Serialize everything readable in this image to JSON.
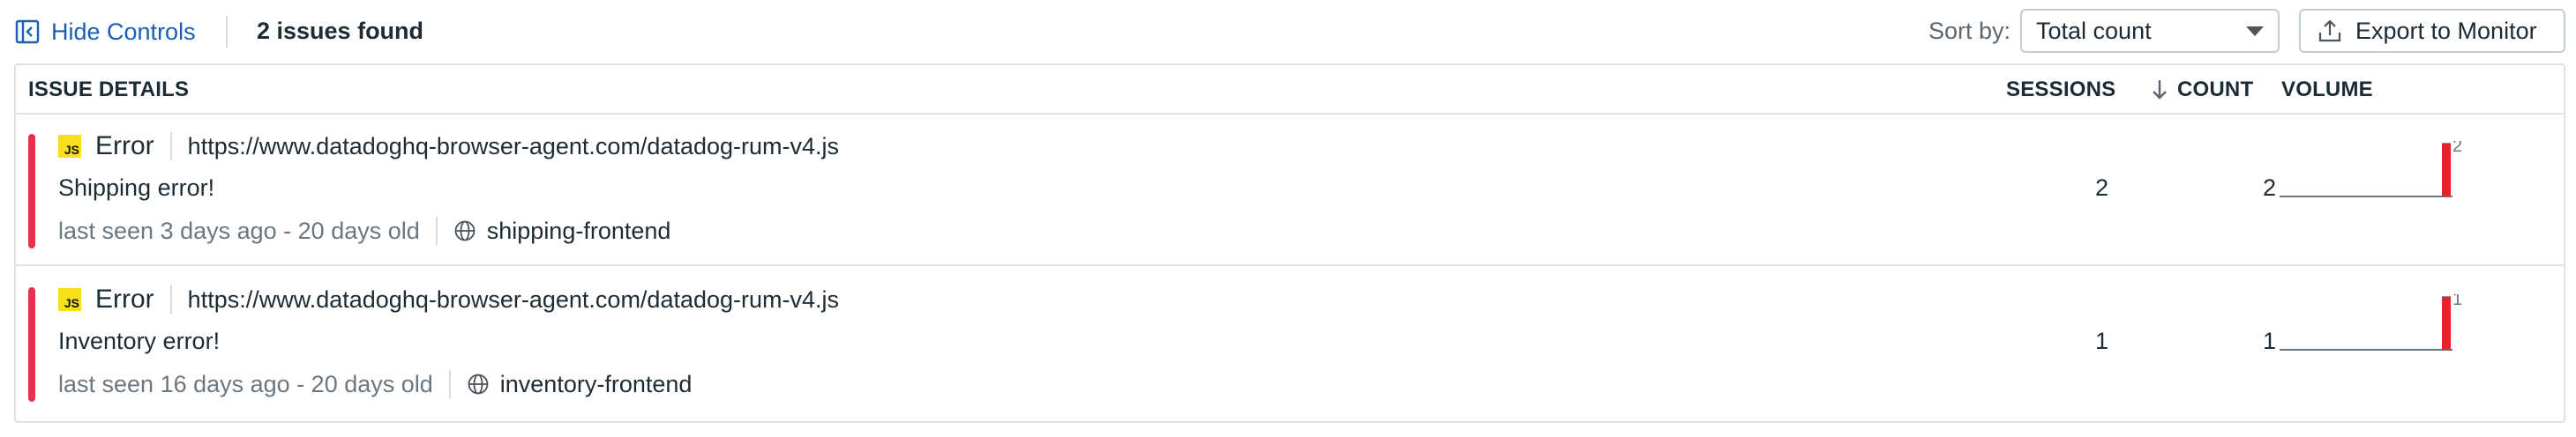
{
  "toolbar": {
    "hide_controls_label": "Hide Controls",
    "issues_found": "2 issues found",
    "sort_label": "Sort by:",
    "sort_value": "Total count",
    "export_label": "Export to Monitor"
  },
  "table": {
    "columns": {
      "details": "ISSUE DETAILS",
      "sessions": "SESSIONS",
      "count": "COUNT",
      "volume": "VOLUME"
    },
    "rows": [
      {
        "badge": "JS",
        "type": "Error",
        "url": "https://www.datadoghq-browser-agent.com/datadog-rum-v4.js",
        "message": "Shipping error!",
        "age": "last seen 3 days ago - 20 days old",
        "service": "shipping-frontend",
        "sessions": "2",
        "count": "2",
        "volume_peak": "2",
        "volume_level": 1.0
      },
      {
        "badge": "JS",
        "type": "Error",
        "url": "https://www.datadoghq-browser-agent.com/datadog-rum-v4.js",
        "message": "Inventory error!",
        "age": "last seen 16 days ago - 20 days old",
        "service": "inventory-frontend",
        "sessions": "1",
        "count": "1",
        "volume_peak": "1",
        "volume_level": 1.0
      }
    ]
  },
  "colors": {
    "severity_error": "#e8314f",
    "volume_bar": "#e8222c",
    "link": "#1a5fb4",
    "js_badge": "#f7df1e"
  },
  "icons": {
    "hide_controls": "collapse-panel-icon",
    "export": "upload-icon",
    "sort_direction": "arrow-down-icon",
    "service": "globe-icon"
  }
}
